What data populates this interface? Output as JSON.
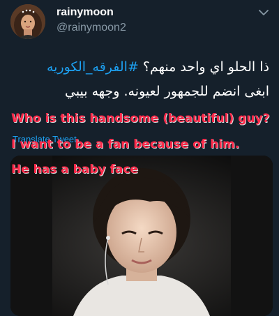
{
  "user": {
    "display_name": "rainymoon",
    "handle": "@rainymoon2"
  },
  "icons": {
    "avatar": "profile-photo",
    "caret": "chevron-down-icon"
  },
  "tweet": {
    "line1_text": "ذا الحلو اي واحد منهم؟ ",
    "hashtag": "#الفرقه_الكوريه",
    "line2_text": "ابغى انضم للجمهور لعيونه. وجهه بيبي",
    "translate_label": "Translate Tweet"
  },
  "overlay_translation": {
    "line1": "Who is this handsome (beautiful) guy?",
    "line2": "I want to be a fan because of him.",
    "line3": "He has a baby face"
  },
  "colors": {
    "background": "#15202b",
    "link": "#1da1f2",
    "secondary_text": "#8899a6",
    "translation_text": "#ff2a4a"
  }
}
